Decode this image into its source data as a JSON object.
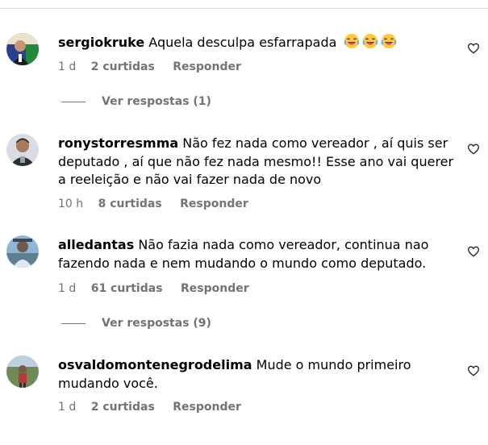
{
  "comments": [
    {
      "username": "sergiokruke",
      "text": "Aquela desculpa esfarrapada",
      "emojis": [
        "face-with-tears-of-joy",
        "face-with-tears-of-joy",
        "face-with-tears-of-joy"
      ],
      "time": "1 d",
      "likes": "2 curtidas",
      "reply": "Responder",
      "view_replies": "Ver respostas (1)"
    },
    {
      "username": "ronystorresmma",
      "text": "Não fez nada como vereador , aí quis ser deputado , aí que não fez nada mesmo!! Esse ano vai querer a reeleição e não vai fazer nada de novo",
      "time": "10 h",
      "likes": "8 curtidas",
      "reply": "Responder"
    },
    {
      "username": "alledantas",
      "text": "Não fazia nada como vereador, continua nao fazendo nada e nem mudando o mundo como deputado.",
      "time": "1 d",
      "likes": "61 curtidas",
      "reply": "Responder",
      "view_replies": "Ver respostas (9)"
    },
    {
      "username": "osvaldomontenegrodelima",
      "text": "Mude o mundo primeiro mudando você.",
      "time": "1 d",
      "likes": "2 curtidas",
      "reply": "Responder"
    }
  ],
  "colors": {
    "secondary_text": "#737373",
    "divider": "#dbdbdb"
  }
}
